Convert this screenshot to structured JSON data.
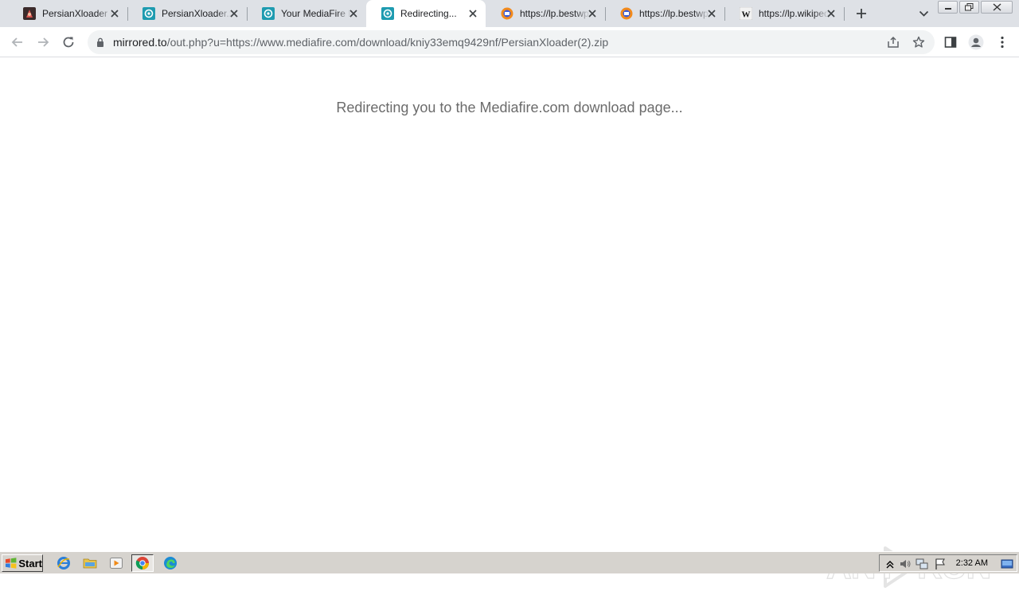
{
  "browser": {
    "tabs": [
      {
        "title": "PersianXloader Desktop",
        "icon": "persianxloader-favicon"
      },
      {
        "title": "PersianXloader.zip - MediaFire",
        "icon": "mediafire-favicon"
      },
      {
        "title": "Your MediaFire Link",
        "icon": "mediafire-favicon"
      },
      {
        "title": "Redirecting...",
        "icon": "mediafire-favicon",
        "active": true
      },
      {
        "title": "https://lp.bestwpro",
        "icon": "firefox-favicon"
      },
      {
        "title": "https://lp.bestwpro",
        "icon": "firefox-favicon"
      },
      {
        "title": "https://lp.wikipedia",
        "icon": "wikipedia-favicon"
      }
    ],
    "address": {
      "host": "mirrored.to",
      "path": "/out.php?u=https://www.mediafire.com/download/kniy33emq9429nf/PersianXloader(2).zip"
    }
  },
  "page": {
    "message": "Redirecting you to the Mediafire.com download page..."
  },
  "watermark": {
    "text_left": "ANY",
    "text_right": "RUN"
  },
  "taskbar": {
    "start_label": "Start",
    "clock": "2:32 AM"
  },
  "colors": {
    "tabstrip": "#dee1e6",
    "omnibox": "#f1f3f4",
    "message": "#6b6b6b",
    "taskbar": "#d6d3ce"
  }
}
